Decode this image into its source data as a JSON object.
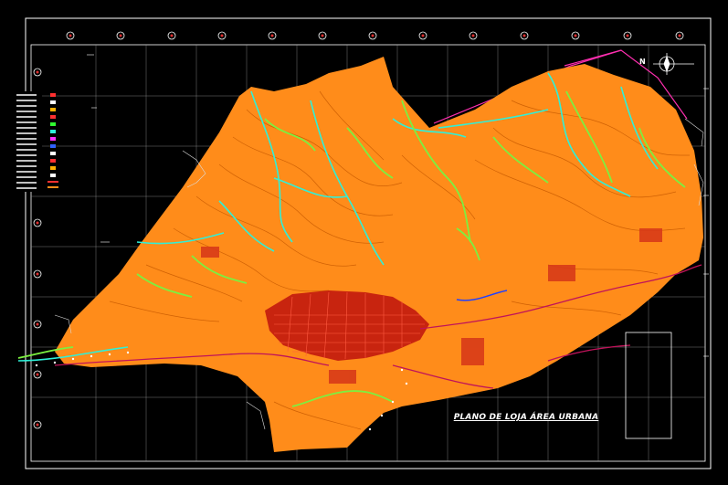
{
  "drawing": {
    "title": "PLANO DE LOJA ÁREA URBANA",
    "north_label": "N"
  },
  "colors": {
    "background": "#000000",
    "terrain_fill": "#ff8c1a",
    "contour_dark": "#c85a00",
    "rivers": "#2ef0d8",
    "streams": "#7cf040",
    "urban": "#e02010",
    "boundary": "#ff2fb0",
    "grid": "#c8c8c8",
    "frame": "#ffffff"
  },
  "icons": [
    "compass-rose-icon",
    "grid-marker-icon"
  ]
}
